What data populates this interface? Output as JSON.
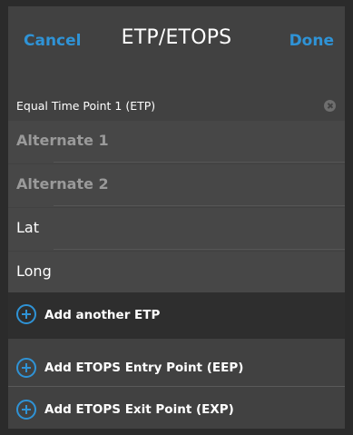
{
  "header": {
    "cancel_label": "Cancel",
    "title": "ETP/ETOPS",
    "done_label": "Done"
  },
  "etp_section": {
    "title": "Equal Time Point 1 (ETP)",
    "fields": [
      {
        "label": "Alternate 1",
        "kind": "placeholder"
      },
      {
        "label": "Alternate 2",
        "kind": "placeholder"
      },
      {
        "label": "Lat",
        "kind": "value"
      },
      {
        "label": "Long",
        "kind": "value"
      }
    ]
  },
  "actions": {
    "add_etp": "Add another ETP",
    "add_eep": "Add ETOPS Entry Point (EEP)",
    "add_exp": "Add ETOPS Exit Point (EXP)"
  },
  "colors": {
    "accent": "#2f93d6",
    "background": "#2b2b2b",
    "panel": "#414141"
  }
}
